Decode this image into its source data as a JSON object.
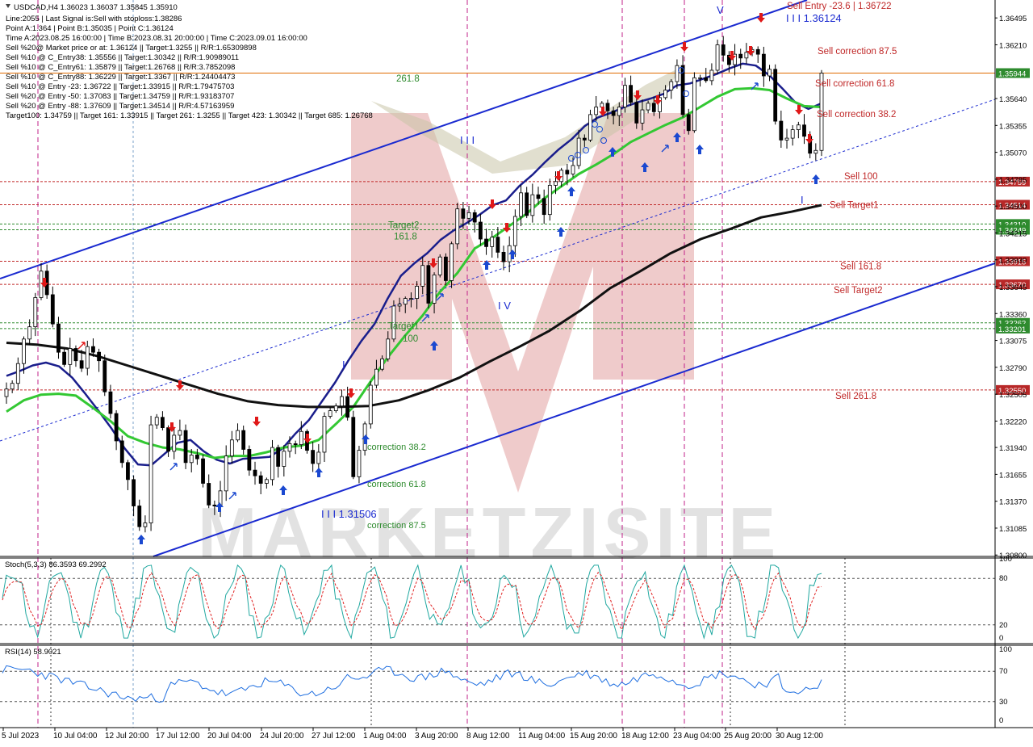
{
  "chart_data": {
    "type": "candlestick",
    "symbol_line": "USDCAD,H4  1.36023 1.36037 1.35845 1.35910",
    "info_lines": [
      "Line:2055 | Last Signal is:Sell with stoploss:1.38286",
      "Point A:1.364 | Point B:1.35035 | Point C:1.36124",
      "Time A:2023.08.25 16:00:00 | Time B:2023.08.31 20:00:00 | Time C:2023.09.01 16:00:00",
      "Sell %20@ Market price or at: 1.36124 || Target:1.3255 || R/R:1.65309898",
      "Sell %10 @ C_Entry38: 1.35556 || Target:1.30342 || R/R:1.90989011",
      "Sell %10 @ C_Entry61: 1.35879 || Target:1.26768 || R/R:3.7852098",
      "Sell %10 @ C_Entry88: 1.36229 || Target:1.3367 || R/R:1.24404473",
      "Sell %10 @ Entry -23: 1.36722 || Target:1.33915 || R/R:1.79475703",
      "Sell %20 @ Entry -50: 1.37083 || Target:1.34759 || R/R:1.93183707",
      "Sell %20 @ Entry -88: 1.37609 || Target:1.34514 || R/R:4.57163959",
      "Target100: 1.34759 || Target 161: 1.33915 || Target 261: 1.3255 || Target 423: 1.30342 || Target 685: 1.26768"
    ],
    "y_ticks": [
      "1.36495",
      "1.36210",
      "1.35640",
      "1.35355",
      "1.35070",
      "1.34785",
      "1.34500",
      "1.34215",
      "1.33930",
      "1.33645",
      "1.33360",
      "1.33075",
      "1.32790",
      "1.32505",
      "1.32220",
      "1.31940",
      "1.31655",
      "1.31370",
      "1.31085",
      "1.30800"
    ],
    "ylim": [
      1.30785,
      1.36685
    ],
    "x_ticks": [
      "5 Jul 2023",
      "10 Jul 04:00",
      "12 Jul 20:00",
      "17 Jul 12:00",
      "20 Jul 04:00",
      "24 Jul 20:00",
      "27 Jul 12:00",
      "1 Aug 04:00",
      "3 Aug 20:00",
      "8 Aug 12:00",
      "11 Aug 04:00",
      "15 Aug 20:00",
      "18 Aug 12:00",
      "23 Aug 04:00",
      "25 Aug 20:00",
      "30 Aug 12:00"
    ],
    "current_price": {
      "value": 1.3591,
      "label": "1.35910",
      "color": "#1a1aaa"
    },
    "price_badge_overlay": {
      "label": "1.35944",
      "color": "#2e8b2e"
    },
    "levels": [
      {
        "name": "Sell Entry -23.6 | 1.36722",
        "value": 1.36722,
        "label": "1.36722",
        "color": "#c02828",
        "text_only": true
      },
      {
        "name": "Sell correction 87.5",
        "value": 1.3624,
        "label": "",
        "color": "#c02828",
        "text_only": true
      },
      {
        "name": "Sell correction 61.8",
        "value": 1.3588,
        "label": "",
        "color": "#c02828",
        "text_only": true
      },
      {
        "name": "Sell correction 38.2",
        "value": 1.3555,
        "label": "",
        "color": "#c02828",
        "text_only": true
      },
      {
        "name": "261.8",
        "value": 1.359,
        "label": "",
        "color": "#2e8b2e",
        "text_only": true
      },
      {
        "name": "Sell 100",
        "value": 1.34759,
        "label": "1.34759",
        "color": "#c02828"
      },
      {
        "name": "Sell Target1",
        "value": 1.34514,
        "label": "1.34514",
        "color": "#c02828"
      },
      {
        "name": "Target2",
        "value": 1.3431,
        "label": "1.34310",
        "color": "#2e8b2e"
      },
      {
        "name": "161.8",
        "value": 1.34249,
        "label": "1.34249",
        "color": "#2e8b2e"
      },
      {
        "name": "Sell 161.8",
        "value": 1.33915,
        "label": "1.33915",
        "color": "#c02828"
      },
      {
        "name": "Sell Target2",
        "value": 1.3367,
        "label": "1.33670",
        "color": "#c02828"
      },
      {
        "name": "Target1",
        "value": 1.33262,
        "label": "1.33262",
        "color": "#2e8b2e"
      },
      {
        "name": "100",
        "value": 1.33201,
        "label": "1.33201",
        "color": "#2e8b2e"
      },
      {
        "name": "Sell  261.8",
        "value": 1.3255,
        "label": "1.32550",
        "color": "#c02828"
      }
    ],
    "corrections": [
      {
        "text": "correction 38.2",
        "value": 1.3193
      },
      {
        "text": "correction 61.8",
        "value": 1.3152
      },
      {
        "text": "correction 87.5",
        "value": 1.3107
      }
    ],
    "waves": [
      {
        "text": "I",
        "value": 1.3295
      },
      {
        "text": "I I I",
        "value": 1.3548
      },
      {
        "text": "I V",
        "value": 1.3371
      },
      {
        "text": "V",
        "value": 1.366
      },
      {
        "text": "I",
        "value": 1.3458
      },
      {
        "text": "I I I 1.36124",
        "value": 1.3663
      },
      {
        "text": "I I I 1.31506",
        "value": 1.3127
      }
    ],
    "series": [
      {
        "name": "close",
        "values": [
          1.3256,
          1.3262,
          1.3283,
          1.3309,
          1.3322,
          1.3353,
          1.3381,
          1.3356,
          1.3325,
          1.3295,
          1.3282,
          1.3299,
          1.3286,
          1.3278,
          1.3301,
          1.3295,
          1.3286,
          1.3253,
          1.323,
          1.3201,
          1.3178,
          1.316,
          1.3132,
          1.311,
          1.3114,
          1.3218,
          1.3226,
          1.3215,
          1.319,
          1.3207,
          1.3212,
          1.3178,
          1.3186,
          1.3182,
          1.3156,
          1.3133,
          1.3132,
          1.3148,
          1.3185,
          1.3202,
          1.3212,
          1.3192,
          1.317,
          1.3164,
          1.3156,
          1.316,
          1.3194,
          1.3174,
          1.319,
          1.3198,
          1.3197,
          1.3211,
          1.3191,
          1.3177,
          1.3189,
          1.3227,
          1.3233,
          1.3238,
          1.3248,
          1.3226,
          1.3163,
          1.3191,
          1.3219,
          1.326,
          1.3277,
          1.3288,
          1.3309,
          1.3344,
          1.3346,
          1.3352,
          1.3352,
          1.3365,
          1.3387,
          1.3347,
          1.3377,
          1.3396,
          1.3371,
          1.341,
          1.3447,
          1.3437,
          1.3443,
          1.3433,
          1.3415,
          1.3407,
          1.3417,
          1.3401,
          1.3391,
          1.3408,
          1.3439,
          1.3464,
          1.344,
          1.3462,
          1.3458,
          1.3441,
          1.3472,
          1.3476,
          1.3488,
          1.3484,
          1.3493,
          1.3522,
          1.352,
          1.3547,
          1.3555,
          1.3559,
          1.3551,
          1.3546,
          1.3555,
          1.3578,
          1.356,
          1.3538,
          1.3552,
          1.3559,
          1.355,
          1.3565,
          1.3573,
          1.3582,
          1.3599,
          1.3547,
          1.353,
          1.3586,
          1.3586,
          1.3583,
          1.3594,
          1.3621,
          1.361,
          1.36,
          1.3611,
          1.3607,
          1.3613,
          1.3616,
          1.3611,
          1.3588,
          1.3595,
          1.354,
          1.352,
          1.3522,
          1.3531,
          1.3536,
          1.3524,
          1.3506,
          1.3509,
          1.3591
        ]
      }
    ],
    "ma_lines": [
      {
        "name": "fast",
        "color": "#1a1e8c",
        "values": [
          1.327,
          1.3275,
          1.3281,
          1.3284,
          1.328,
          1.3268,
          1.3251,
          1.3233,
          1.3214,
          1.3193,
          1.3176,
          1.3175,
          1.3187,
          1.3199,
          1.3202,
          1.319,
          1.3181,
          1.3177,
          1.3182,
          1.3183,
          1.3184,
          1.3193,
          1.3209,
          1.3223,
          1.3243,
          1.3263,
          1.3286,
          1.3307,
          1.3325,
          1.3352,
          1.3376,
          1.3389,
          1.34,
          1.3414,
          1.3424,
          1.3432,
          1.3441,
          1.3451,
          1.3456,
          1.3471,
          1.3483,
          1.3497,
          1.351,
          1.3521,
          1.3535,
          1.3544,
          1.3549,
          1.3555,
          1.356,
          1.3564,
          1.3569,
          1.3578,
          1.358,
          1.3585,
          1.359,
          1.3596,
          1.3601,
          1.3599,
          1.3589,
          1.3575,
          1.356,
          1.3553,
          1.3559
        ]
      },
      {
        "name": "mid",
        "color": "#33c833",
        "values": [
          1.3232,
          1.3244,
          1.325,
          1.3251,
          1.3249,
          1.3236,
          1.3222,
          1.3206,
          1.3199,
          1.3194,
          1.3192,
          1.3188,
          1.3183,
          1.3185,
          1.3185,
          1.3189,
          1.3194,
          1.3196,
          1.3202,
          1.3219,
          1.3237,
          1.3264,
          1.329,
          1.3313,
          1.3334,
          1.3359,
          1.3379,
          1.3405,
          1.3416,
          1.3429,
          1.3442,
          1.3458,
          1.3471,
          1.3484,
          1.3494,
          1.3505,
          1.3518,
          1.3527,
          1.3536,
          1.3544,
          1.3555,
          1.3566,
          1.3574,
          1.3575,
          1.3573,
          1.3564,
          1.3556,
          1.3555
        ]
      },
      {
        "name": "slow",
        "color": "#111111",
        "values": [
          1.3305,
          1.3303,
          1.3299,
          1.3291,
          1.3281,
          1.3271,
          1.3261,
          1.3251,
          1.3243,
          1.3239,
          1.3237,
          1.3237,
          1.3238,
          1.3244,
          1.3255,
          1.3268,
          1.3285,
          1.3301,
          1.3318,
          1.3339,
          1.3363,
          1.3381,
          1.34,
          1.3415,
          1.3426,
          1.3438,
          1.3444,
          1.3451
        ]
      }
    ],
    "stoch": {
      "title": "Stoch(5,3,3) 86.3593 69.2992",
      "value_k": 86.3593,
      "value_d": 69.2992,
      "levels": [
        20,
        80
      ],
      "y_ticks": [
        "100",
        "80",
        "20",
        "0"
      ]
    },
    "rsi": {
      "title": "RSI(14) 58.9021",
      "value": 58.9021,
      "levels": [
        30,
        70
      ],
      "y_ticks": [
        "100",
        "70",
        "30",
        "0"
      ]
    },
    "watermark": "MARKETZISITE"
  }
}
